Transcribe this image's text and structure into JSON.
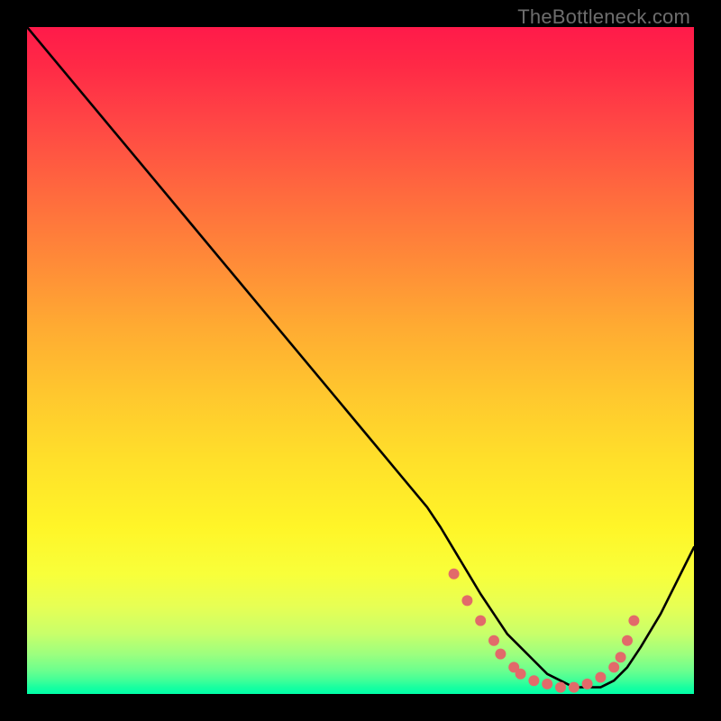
{
  "watermark": "TheBottleneck.com",
  "chart_data": {
    "type": "line",
    "title": "",
    "xlabel": "",
    "ylabel": "",
    "xlim": [
      0,
      100
    ],
    "ylim": [
      0,
      100
    ],
    "grid": false,
    "series": [
      {
        "name": "curve",
        "x": [
          0,
          5,
          10,
          15,
          20,
          25,
          30,
          35,
          40,
          45,
          50,
          55,
          60,
          62,
          65,
          68,
          70,
          72,
          74,
          76,
          78,
          80,
          82,
          84,
          86,
          88,
          90,
          92,
          95,
          100
        ],
        "y": [
          100,
          94,
          88,
          82,
          76,
          70,
          64,
          58,
          52,
          46,
          40,
          34,
          28,
          25,
          20,
          15,
          12,
          9,
          7,
          5,
          3,
          2,
          1,
          1,
          1,
          2,
          4,
          7,
          12,
          22
        ],
        "color": "#000000"
      }
    ],
    "markers": [
      {
        "x": 64,
        "y": 18
      },
      {
        "x": 66,
        "y": 14
      },
      {
        "x": 68,
        "y": 11
      },
      {
        "x": 70,
        "y": 8
      },
      {
        "x": 71,
        "y": 6
      },
      {
        "x": 73,
        "y": 4
      },
      {
        "x": 74,
        "y": 3
      },
      {
        "x": 76,
        "y": 2
      },
      {
        "x": 78,
        "y": 1.5
      },
      {
        "x": 80,
        "y": 1
      },
      {
        "x": 82,
        "y": 1
      },
      {
        "x": 84,
        "y": 1.5
      },
      {
        "x": 86,
        "y": 2.5
      },
      {
        "x": 88,
        "y": 4
      },
      {
        "x": 89,
        "y": 5.5
      },
      {
        "x": 90,
        "y": 8
      },
      {
        "x": 91,
        "y": 11
      }
    ],
    "marker_color": "#e26a6a",
    "marker_radius": 6
  }
}
